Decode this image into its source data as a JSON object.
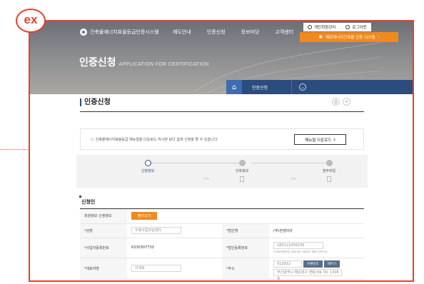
{
  "badge": "ex",
  "colors": {
    "accent": "#e8402a",
    "orange": "#f08a1c",
    "navy": "#2b4c7e"
  },
  "header": {
    "logo_text": "건축물에너지효율등급인증시스템",
    "nav": [
      "제도안내",
      "인증신청",
      "정보마당",
      "고객센터"
    ],
    "util": {
      "signup": "개인회원관리",
      "logout": "로그아웃"
    },
    "system_button": "제로에너지건축물 인증 시스템"
  },
  "hero": {
    "title": "인증신청",
    "subtitle": "APPLICATION FOR CERTIFICATION"
  },
  "breadcrumb": {
    "home_icon": "home-icon",
    "current": "인증신청"
  },
  "page": {
    "title": "인증신청"
  },
  "notice": {
    "text": "ⓘ 건축물에너지효율등급 메뉴얼을 다운로드 하시면 보다 쉽게 신청을 할 수 있습니다.",
    "download_button": "메뉴얼 다운로드"
  },
  "steps": [
    {
      "label": "신청정보",
      "active": true
    },
    {
      "label": "건축정보",
      "active": false
    },
    {
      "label": "첨부파일",
      "active": false
    }
  ],
  "section": {
    "title": "신청인",
    "rows": [
      {
        "label": "회원정보 신청정보",
        "value": "",
        "button": "불러오기"
      },
      {
        "label": "*성명",
        "value": "우정사업조달센터",
        "label2": "*법인명",
        "value2": "(주)한양티아"
      },
      {
        "label": "*사업자등록번호",
        "value": "6330307733",
        "label2": "*법인등록번호",
        "value2": "180111056239",
        "note": "※ 법인등록번호 입력(개인 사업자는 생략) 입력가능"
      },
      {
        "label": "*대표자명",
        "value": "이개호",
        "label2": "*주소",
        "zip": "012912",
        "zip_button": "우편번호",
        "zip_button2": "재주기",
        "address": "부산광역시 해운대구 센텀서로 30, 1306호"
      }
    ]
  }
}
